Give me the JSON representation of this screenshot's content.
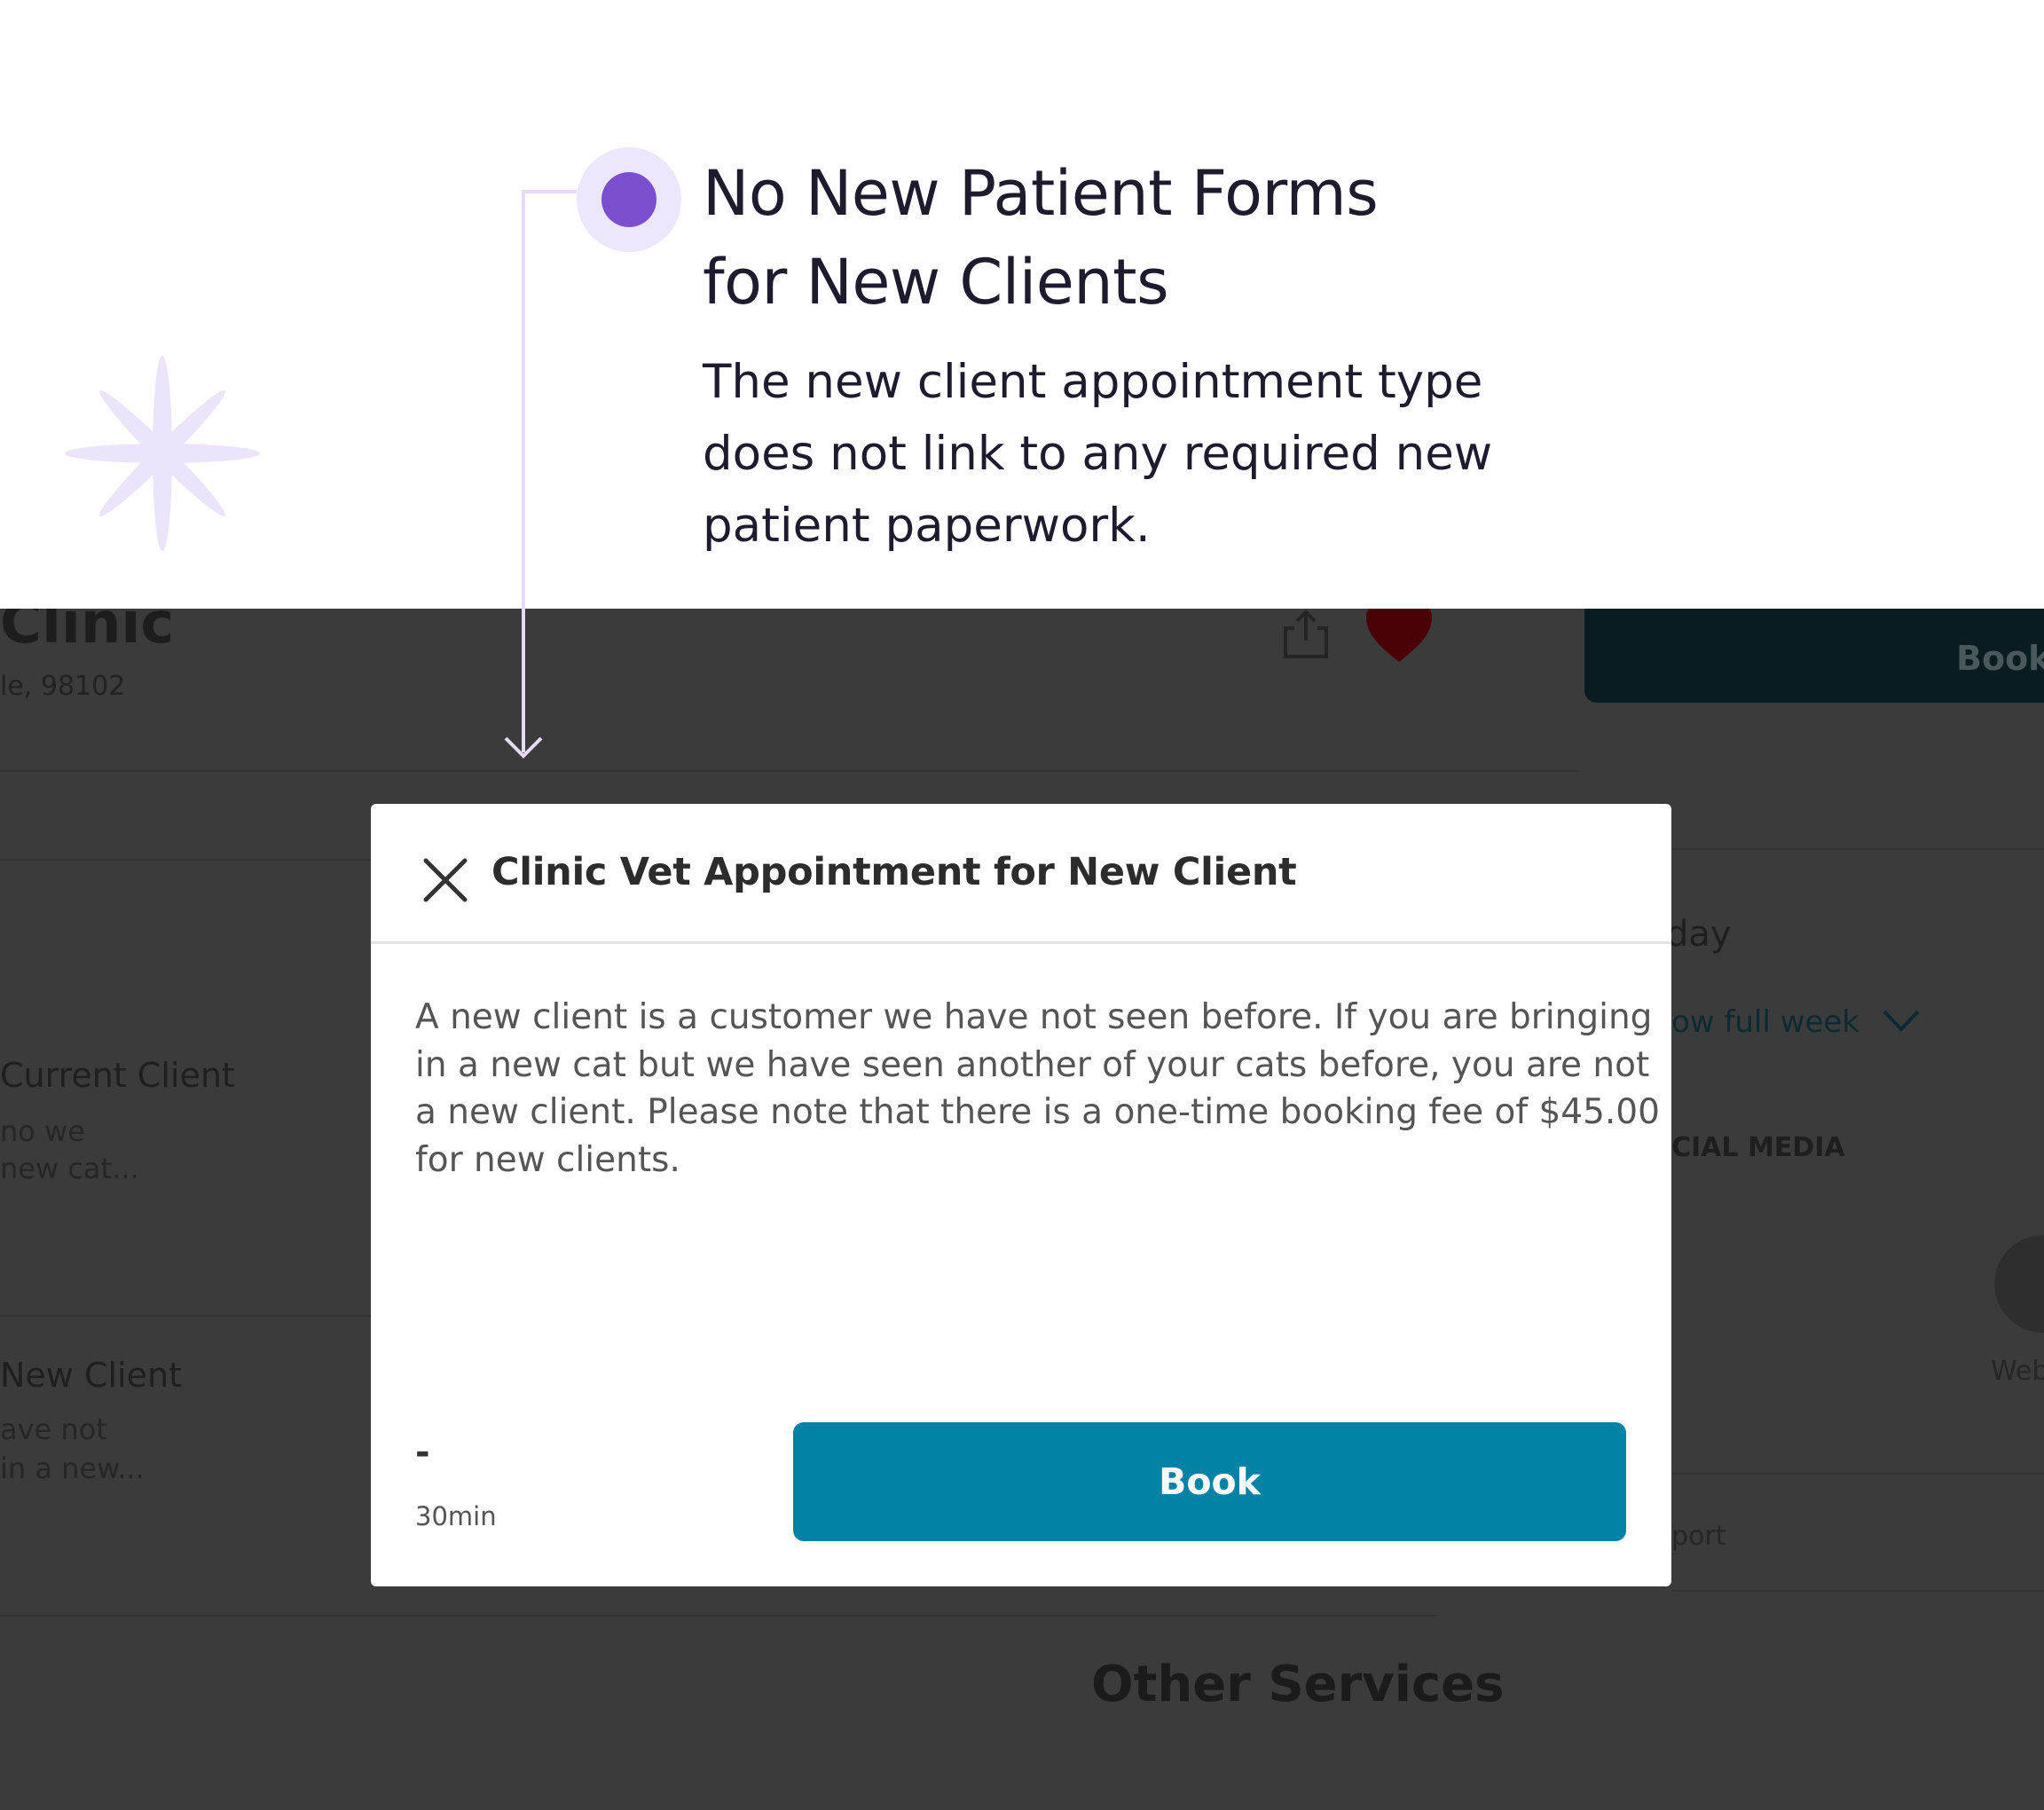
{
  "annotation": {
    "title_lines": [
      "No New Patient Forms",
      "for New Clients"
    ],
    "body_lines": [
      "The new client appointment type",
      "does not link to any required new",
      "patient paperwork."
    ],
    "accent_color": "#7b4fd0",
    "bullet_halo_color": "#ede7fb",
    "connector_color": "#e4dbf6",
    "sparkle_icon": "asterisk-sparkle"
  },
  "background": {
    "clinic_name": "Clinic",
    "address": "le, 98102",
    "book_label": "Book",
    "services": [
      {
        "title": "Current Client",
        "desc_lines": [
          "no we",
          "new cat..."
        ]
      },
      {
        "title": "New Client",
        "desc_lines": [
          "ave not",
          "in a new..."
        ]
      }
    ],
    "hours_day": "day",
    "show_full_week": "ow full week",
    "social_media": "CIAL MEDIA",
    "website_label": "Web",
    "report_label": "port",
    "other_services": "Other Services",
    "overlay_color": "#3b3b3b"
  },
  "modal": {
    "title": "Clinic Vet Appointment for New Client",
    "description_lines": [
      "A new client is a customer we have not seen before. If you are bringing",
      "in a new cat but we have seen another of your cats before, you are not",
      "a new client. Please note that there is a one-time booking fee of $45.00",
      "for new clients."
    ],
    "price": "-",
    "duration": "30min",
    "book_label": "Book",
    "book_color": "#0283a6"
  }
}
